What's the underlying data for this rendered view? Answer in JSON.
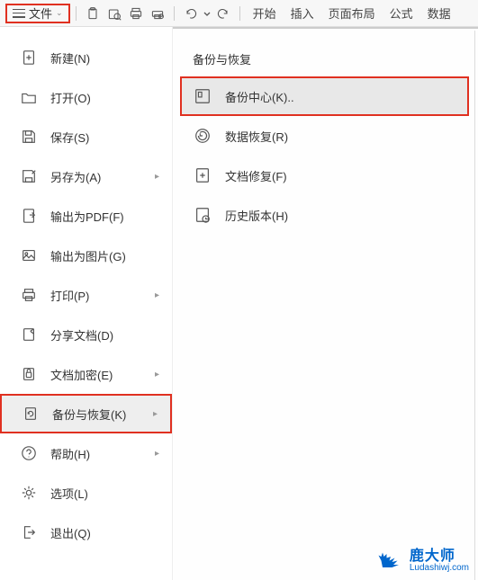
{
  "toolbar": {
    "file_label": "文件",
    "tabs": [
      "开始",
      "插入",
      "页面布局",
      "公式",
      "数据"
    ]
  },
  "file_menu": {
    "items": [
      {
        "label": "新建(N)",
        "name": "new"
      },
      {
        "label": "打开(O)",
        "name": "open"
      },
      {
        "label": "保存(S)",
        "name": "save"
      },
      {
        "label": "另存为(A)",
        "name": "save-as",
        "arrow": true
      },
      {
        "label": "输出为PDF(F)",
        "name": "export-pdf"
      },
      {
        "label": "输出为图片(G)",
        "name": "export-image"
      },
      {
        "label": "打印(P)",
        "name": "print",
        "arrow": true
      },
      {
        "label": "分享文档(D)",
        "name": "share"
      },
      {
        "label": "文档加密(E)",
        "name": "encrypt",
        "arrow": true
      },
      {
        "label": "备份与恢复(K)",
        "name": "backup-restore",
        "arrow": true,
        "selected": true,
        "highlight": true
      },
      {
        "label": "帮助(H)",
        "name": "help",
        "arrow": true
      },
      {
        "label": "选项(L)",
        "name": "options"
      },
      {
        "label": "退出(Q)",
        "name": "exit"
      }
    ]
  },
  "submenu": {
    "title": "备份与恢复",
    "items": [
      {
        "label": "备份中心(K)..",
        "name": "backup-center",
        "selected": true,
        "highlight": true
      },
      {
        "label": "数据恢复(R)",
        "name": "data-recovery"
      },
      {
        "label": "文档修复(F)",
        "name": "doc-repair"
      },
      {
        "label": "历史版本(H)",
        "name": "history-version"
      }
    ]
  },
  "watermark": {
    "cn": "鹿大师",
    "en": "Ludashiwj.com"
  }
}
